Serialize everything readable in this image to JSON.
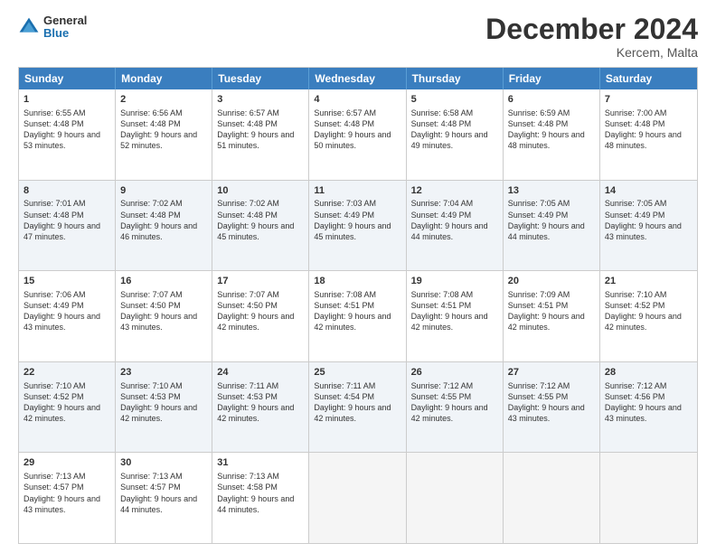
{
  "header": {
    "logo_general": "General",
    "logo_blue": "Blue",
    "month_title": "December 2024",
    "location": "Kercem, Malta"
  },
  "weekdays": [
    "Sunday",
    "Monday",
    "Tuesday",
    "Wednesday",
    "Thursday",
    "Friday",
    "Saturday"
  ],
  "rows": [
    [
      {
        "day": "1",
        "sunrise": "Sunrise: 6:55 AM",
        "sunset": "Sunset: 4:48 PM",
        "daylight": "Daylight: 9 hours and 53 minutes."
      },
      {
        "day": "2",
        "sunrise": "Sunrise: 6:56 AM",
        "sunset": "Sunset: 4:48 PM",
        "daylight": "Daylight: 9 hours and 52 minutes."
      },
      {
        "day": "3",
        "sunrise": "Sunrise: 6:57 AM",
        "sunset": "Sunset: 4:48 PM",
        "daylight": "Daylight: 9 hours and 51 minutes."
      },
      {
        "day": "4",
        "sunrise": "Sunrise: 6:57 AM",
        "sunset": "Sunset: 4:48 PM",
        "daylight": "Daylight: 9 hours and 50 minutes."
      },
      {
        "day": "5",
        "sunrise": "Sunrise: 6:58 AM",
        "sunset": "Sunset: 4:48 PM",
        "daylight": "Daylight: 9 hours and 49 minutes."
      },
      {
        "day": "6",
        "sunrise": "Sunrise: 6:59 AM",
        "sunset": "Sunset: 4:48 PM",
        "daylight": "Daylight: 9 hours and 48 minutes."
      },
      {
        "day": "7",
        "sunrise": "Sunrise: 7:00 AM",
        "sunset": "Sunset: 4:48 PM",
        "daylight": "Daylight: 9 hours and 48 minutes."
      }
    ],
    [
      {
        "day": "8",
        "sunrise": "Sunrise: 7:01 AM",
        "sunset": "Sunset: 4:48 PM",
        "daylight": "Daylight: 9 hours and 47 minutes."
      },
      {
        "day": "9",
        "sunrise": "Sunrise: 7:02 AM",
        "sunset": "Sunset: 4:48 PM",
        "daylight": "Daylight: 9 hours and 46 minutes."
      },
      {
        "day": "10",
        "sunrise": "Sunrise: 7:02 AM",
        "sunset": "Sunset: 4:48 PM",
        "daylight": "Daylight: 9 hours and 45 minutes."
      },
      {
        "day": "11",
        "sunrise": "Sunrise: 7:03 AM",
        "sunset": "Sunset: 4:49 PM",
        "daylight": "Daylight: 9 hours and 45 minutes."
      },
      {
        "day": "12",
        "sunrise": "Sunrise: 7:04 AM",
        "sunset": "Sunset: 4:49 PM",
        "daylight": "Daylight: 9 hours and 44 minutes."
      },
      {
        "day": "13",
        "sunrise": "Sunrise: 7:05 AM",
        "sunset": "Sunset: 4:49 PM",
        "daylight": "Daylight: 9 hours and 44 minutes."
      },
      {
        "day": "14",
        "sunrise": "Sunrise: 7:05 AM",
        "sunset": "Sunset: 4:49 PM",
        "daylight": "Daylight: 9 hours and 43 minutes."
      }
    ],
    [
      {
        "day": "15",
        "sunrise": "Sunrise: 7:06 AM",
        "sunset": "Sunset: 4:49 PM",
        "daylight": "Daylight: 9 hours and 43 minutes."
      },
      {
        "day": "16",
        "sunrise": "Sunrise: 7:07 AM",
        "sunset": "Sunset: 4:50 PM",
        "daylight": "Daylight: 9 hours and 43 minutes."
      },
      {
        "day": "17",
        "sunrise": "Sunrise: 7:07 AM",
        "sunset": "Sunset: 4:50 PM",
        "daylight": "Daylight: 9 hours and 42 minutes."
      },
      {
        "day": "18",
        "sunrise": "Sunrise: 7:08 AM",
        "sunset": "Sunset: 4:51 PM",
        "daylight": "Daylight: 9 hours and 42 minutes."
      },
      {
        "day": "19",
        "sunrise": "Sunrise: 7:08 AM",
        "sunset": "Sunset: 4:51 PM",
        "daylight": "Daylight: 9 hours and 42 minutes."
      },
      {
        "day": "20",
        "sunrise": "Sunrise: 7:09 AM",
        "sunset": "Sunset: 4:51 PM",
        "daylight": "Daylight: 9 hours and 42 minutes."
      },
      {
        "day": "21",
        "sunrise": "Sunrise: 7:10 AM",
        "sunset": "Sunset: 4:52 PM",
        "daylight": "Daylight: 9 hours and 42 minutes."
      }
    ],
    [
      {
        "day": "22",
        "sunrise": "Sunrise: 7:10 AM",
        "sunset": "Sunset: 4:52 PM",
        "daylight": "Daylight: 9 hours and 42 minutes."
      },
      {
        "day": "23",
        "sunrise": "Sunrise: 7:10 AM",
        "sunset": "Sunset: 4:53 PM",
        "daylight": "Daylight: 9 hours and 42 minutes."
      },
      {
        "day": "24",
        "sunrise": "Sunrise: 7:11 AM",
        "sunset": "Sunset: 4:53 PM",
        "daylight": "Daylight: 9 hours and 42 minutes."
      },
      {
        "day": "25",
        "sunrise": "Sunrise: 7:11 AM",
        "sunset": "Sunset: 4:54 PM",
        "daylight": "Daylight: 9 hours and 42 minutes."
      },
      {
        "day": "26",
        "sunrise": "Sunrise: 7:12 AM",
        "sunset": "Sunset: 4:55 PM",
        "daylight": "Daylight: 9 hours and 42 minutes."
      },
      {
        "day": "27",
        "sunrise": "Sunrise: 7:12 AM",
        "sunset": "Sunset: 4:55 PM",
        "daylight": "Daylight: 9 hours and 43 minutes."
      },
      {
        "day": "28",
        "sunrise": "Sunrise: 7:12 AM",
        "sunset": "Sunset: 4:56 PM",
        "daylight": "Daylight: 9 hours and 43 minutes."
      }
    ],
    [
      {
        "day": "29",
        "sunrise": "Sunrise: 7:13 AM",
        "sunset": "Sunset: 4:57 PM",
        "daylight": "Daylight: 9 hours and 43 minutes."
      },
      {
        "day": "30",
        "sunrise": "Sunrise: 7:13 AM",
        "sunset": "Sunset: 4:57 PM",
        "daylight": "Daylight: 9 hours and 44 minutes."
      },
      {
        "day": "31",
        "sunrise": "Sunrise: 7:13 AM",
        "sunset": "Sunset: 4:58 PM",
        "daylight": "Daylight: 9 hours and 44 minutes."
      },
      null,
      null,
      null,
      null
    ]
  ]
}
